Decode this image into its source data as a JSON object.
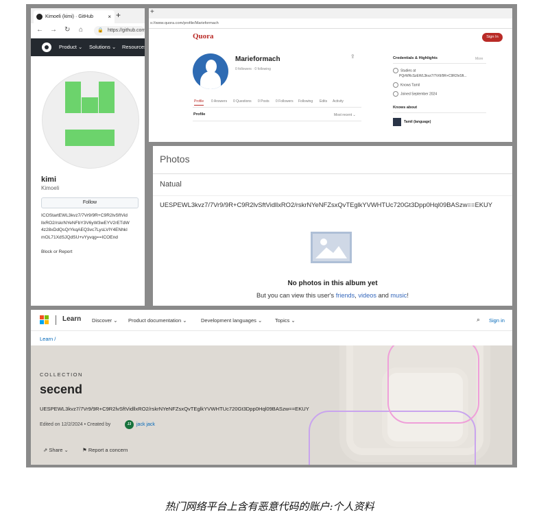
{
  "github": {
    "tab_title": "Kimoeli (kimi) · GitHub",
    "tab_close": "×",
    "new_tab": "+",
    "url": "https://github.com",
    "menu": [
      "Product",
      "Solutions",
      "Resources"
    ],
    "name": "kimi",
    "login": "Kimoeli",
    "follow_label": "Follow",
    "bio_lines": [
      "ICOStartEWL3kvz7/7Vr9/9R+C9R2lvSftVid",
      "llxRO2/rskrNYeNFbY3V6yW3wEYV2rETdW",
      "4z28xDdQsQrYkqAEQ3vc7LysLVlY4ENhkl",
      "mOL71XdSJQdSU+vYyvqg==ICOEnd"
    ],
    "block_label": "Block or Report"
  },
  "quora": {
    "url": "s://www.quora.com/profile/Marieformach",
    "logo": "Quora",
    "sign_in": "Sign In",
    "name": "Marieformach",
    "stats": "0 followers · 0 following",
    "tabs": [
      "Profile",
      "0 Answers",
      "0 Questions",
      "0 Posts",
      "0 Followers",
      "Following",
      "Edits",
      "Activity"
    ],
    "profile_label": "Profile",
    "sort_label": "Most recent",
    "cred_title": "Credentials & Highlights",
    "more": "More",
    "studies_1": "Studies at",
    "studies_2": "PQrWRcSzEWL3kvz7/7Vr9/9R+C9R2lvSft...",
    "knows_tamil": "Knows Tamil",
    "joined": "Joined September 2024",
    "knows_about": "Knows about",
    "topic": "Tamil (language)"
  },
  "photos": {
    "title": "Photos",
    "album": "Natual",
    "code": "UESPEWL3kvz7/7Vr9/9R+C9R2lvSftVidllxRO2/rskrNYeNFZsxQvTEglkYVWHTUc720Gt3Dpp0Hql09BASzw==EKUY",
    "empty_title": "No photos in this album yet",
    "sub_prefix": "But you can view this user's ",
    "link_friends": "friends",
    "sep1": ", ",
    "link_videos": "videos",
    "sep2": " and ",
    "link_music": "music",
    "sub_suffix": "!"
  },
  "learn": {
    "brand": "Learn",
    "menu": [
      "Discover",
      "Product documentation",
      "Development languages",
      "Topics"
    ],
    "sign_in": "Sign in",
    "breadcrumb": "Learn  /",
    "collection_label": "COLLECTION",
    "title": "secend",
    "description": "UESPEWL3kvz7/7Vr9/9R+C9R2lvSftVidllxRO2/rskrNYeNFZsxQvTEglkYVWHTUc720Gt3Dpp0Hql09BASzw==EKUY",
    "meta": "Edited on 12/2/2024 • Created by",
    "avatar_initials": "JJ",
    "author": "jack jack",
    "share": "Share",
    "report": "Report a concern",
    "logo_colors": [
      "#f25022",
      "#7fba00",
      "#00a4ef",
      "#ffb900"
    ]
  },
  "caption": "热门网络平台上含有恶意代码的账户:个人资料"
}
